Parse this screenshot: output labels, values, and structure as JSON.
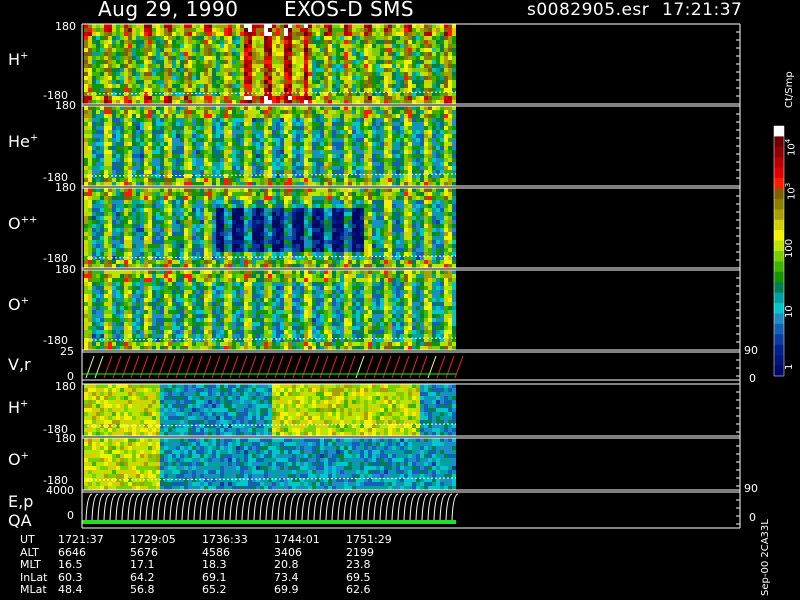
{
  "header": {
    "date": "Aug 29, 1990",
    "instrument": "EXOS-D SMS",
    "file": "s0082905.esr",
    "time": "17:21:37"
  },
  "panels": [
    {
      "label": "H",
      "charge": "+",
      "top_tick": "180",
      "bottom_tick": "-180"
    },
    {
      "label": "He",
      "charge": "+",
      "top_tick": "180",
      "bottom_tick": "-180"
    },
    {
      "label": "O",
      "charge": "++",
      "top_tick": "180",
      "bottom_tick": "-180"
    },
    {
      "label": "O",
      "charge": "+",
      "top_tick": "180",
      "bottom_tick": "-180"
    },
    {
      "label": "V,r",
      "charge": "",
      "top_tick": "25",
      "bottom_tick": "0",
      "right_top": "90",
      "right_bottom": "0"
    },
    {
      "label": "H",
      "charge": "+",
      "top_tick": "180",
      "bottom_tick": "-180"
    },
    {
      "label": "O",
      "charge": "+",
      "top_tick": "180",
      "bottom_tick": "-180"
    },
    {
      "label": "E,p",
      "label2": "QA",
      "charge": "",
      "top_tick": "4000",
      "bottom_tick": "0",
      "right_top": "90",
      "right_bottom": "0"
    }
  ],
  "colorbar": {
    "unit": "Ct/Smp",
    "tick_labels": [
      "10",
      "100",
      "10",
      "10",
      "1"
    ],
    "tick_exponents": [
      "4",
      "",
      "3",
      "",
      ""
    ],
    "colors": [
      "#ffffff",
      "#6a0000",
      "#900000",
      "#b80000",
      "#e00000",
      "#ff1a00",
      "#806000",
      "#8c8000",
      "#a8a000",
      "#d2d200",
      "#f2f200",
      "#b8e600",
      "#78d000",
      "#3cb400",
      "#149600",
      "#007f50",
      "#00a0a0",
      "#00c8c8",
      "#1e8cc8",
      "#1460b4",
      "#0a3ca0",
      "#00208c",
      "#00147a",
      "#000a64"
    ]
  },
  "ephemeris": {
    "rows": [
      {
        "name": "UT",
        "values": [
          "1721:37",
          "1729:05",
          "1736:33",
          "1744:01",
          "1751:29"
        ]
      },
      {
        "name": "ALT",
        "values": [
          "6646",
          "5676",
          "4586",
          "3406",
          "2199"
        ]
      },
      {
        "name": "MLT",
        "values": [
          "16.5",
          "17.1",
          "18.3",
          "20.8",
          "23.8"
        ]
      },
      {
        "name": "InLat",
        "values": [
          "60.3",
          "64.2",
          "69.1",
          "73.4",
          "69.5"
        ]
      },
      {
        "name": "MLat",
        "values": [
          "48.4",
          "56.8",
          "65.2",
          "69.9",
          "62.6"
        ]
      }
    ]
  },
  "footer_note": "Sep-00 2CA33L",
  "chart_data": {
    "type": "heatmap",
    "description_units": "pitch angle (deg) vs universal time, color = counts per sample",
    "x_ticks_ut": [
      "1721:37",
      "1729:05",
      "1736:33",
      "1744:01",
      "1751:29"
    ],
    "ylim_angle": [
      -180,
      180
    ],
    "colorbar_range": [
      1,
      10000
    ],
    "colorbar_scale": "log",
    "data_end_fraction_of_time_axis": 0.56
  }
}
